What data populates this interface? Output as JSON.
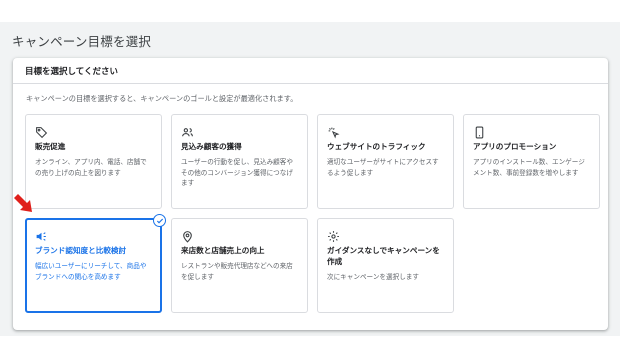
{
  "page": {
    "title": "キャンペーン目標を選択"
  },
  "panel": {
    "header": "目標を選択してください",
    "description": "キャンペーンの目標を選択すると、キャンペーンのゴールと設定が最適化されます。"
  },
  "cards": [
    {
      "icon": "tag-icon",
      "title": "販売促進",
      "desc": "オンライン、アプリ内、電話、店舗での売り上げの向上を図ります",
      "selected": false
    },
    {
      "icon": "people-icon",
      "title": "見込み顧客の獲得",
      "desc": "ユーザーの行動を促し、見込み顧客やその他のコンバージョン獲得につなげます",
      "selected": false
    },
    {
      "icon": "cursor-click-icon",
      "title": "ウェブサイトのトラフィック",
      "desc": "適切なユーザーがサイトにアクセスするよう促します",
      "selected": false
    },
    {
      "icon": "mobile-phone-icon",
      "title": "アプリのプロモーション",
      "desc": "アプリのインストール数、エンゲージメント数、事前登録数を増やします",
      "selected": false
    },
    {
      "icon": "megaphone-icon",
      "title": "ブランド認知度と比較検討",
      "desc": "幅広いユーザーにリーチして、商品やブランドへの関心を高めます",
      "selected": true
    },
    {
      "icon": "location-pin-icon",
      "title": "来店数と店舗売上の向上",
      "desc": "レストランや販売代理店などへの来店を促します",
      "selected": false
    },
    {
      "icon": "gear-icon",
      "title": "ガイダンスなしでキャンペーンを作成",
      "desc": "次にキャンペーンを選択します",
      "selected": false
    }
  ],
  "colors": {
    "accent": "#1a73e8",
    "annotation_arrow": "#e0201b"
  }
}
